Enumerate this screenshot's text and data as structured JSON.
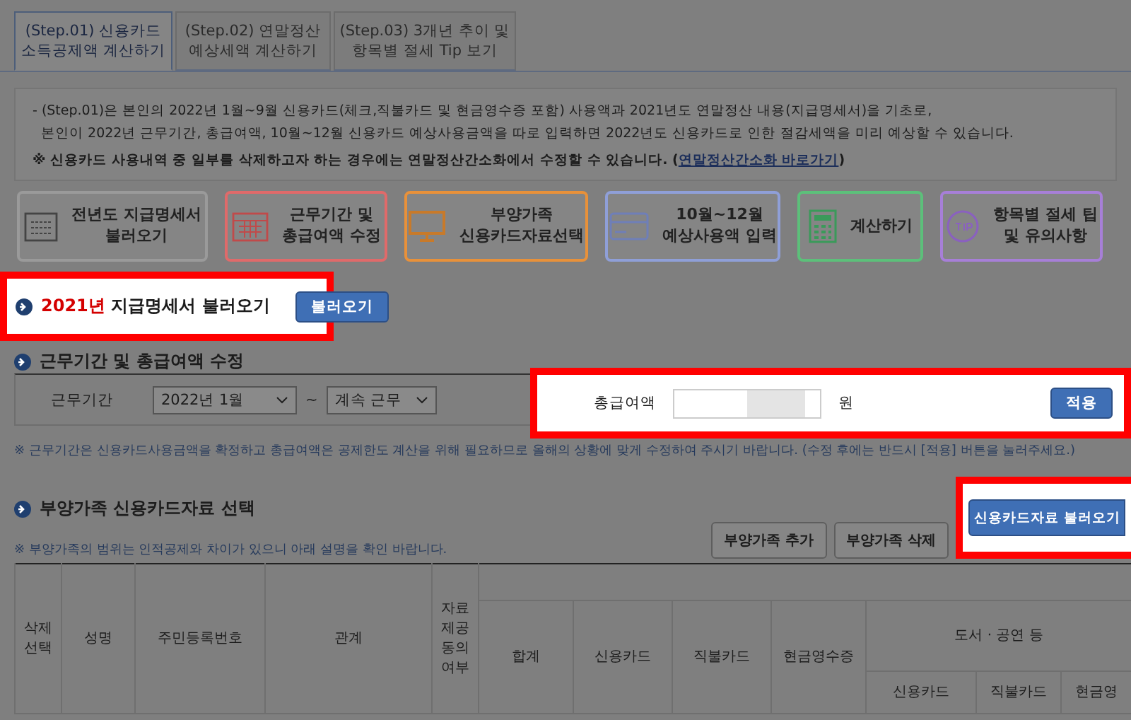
{
  "tabs": [
    {
      "label": "(Step.01) 신용카드\n소득공제액 계산하기",
      "selected": true
    },
    {
      "label": "(Step.02) 연말정산\n예상세액 계산하기",
      "selected": false
    },
    {
      "label": "(Step.03) 3개년 추이 및\n항목별 절세 Tip 보기",
      "selected": false
    }
  ],
  "notice": {
    "lines": [
      "- (Step.01)은 본인의 2022년 1월~9월 신용카드(체크,직불카드 및 현금영수증 포함) 사용액과 2021년도 연말정산 내용(지급명세서)을 기초로,",
      "본인이 2022년 근무기간, 총급여액, 10월~12월 신용카드 예상사용금액을 따로 입력하면 2022년도 신용카드로 인한 절감세액을 미리 예상할 수 있습니다."
    ],
    "note": "※ 신용카드 사용내역 중 일부를 삭제하고자 하는 경우에는 연말정산간소화에서 수정할 수 있습니다. (",
    "link": "연말정산간소화 바로가기",
    "note_end": ")"
  },
  "steps": [
    {
      "label": "전년도 지급명세서\n불러오기",
      "color": "#9a9a9a"
    },
    {
      "label": "근무기간 및\n총급여액 수정",
      "color": "#e06a6a"
    },
    {
      "label": "부양가족\n신용카드자료선택",
      "color": "#e8913a"
    },
    {
      "label": "10월~12월\n예상사용액 입력",
      "color": "#8f9fd8"
    },
    {
      "label": "계산하기",
      "color": "#5cc07a"
    },
    {
      "label": "항목별 절세 팁\n및 유의사항",
      "color": "#a77fd8"
    }
  ],
  "load_statement": {
    "year": "2021년",
    "title": "지급명세서 불러오기",
    "button": "불러오기",
    "highlighted": true
  },
  "work": {
    "title": "근무기간 및 총급여액 수정",
    "period_label": "근무기간",
    "start": "2022년 1월",
    "tilde": "~",
    "end": "계속 근무",
    "salary_label": "총급여액",
    "unit": "원",
    "apply": "적용",
    "highlighted": true,
    "note": "※ 근무기간은 신용카드사용금액을 확정하고 총급여액은 공제한도 계산을 위해 필요하므로 올해의 상황에 맞게 수정하여 주시기 바랍니다. (수정 후에는 반드시 [적용] 버튼을 눌러주세요.)"
  },
  "dependents": {
    "title": "부양가족 신용카드자료 선택",
    "note": "※ 부양가족의 범위는 인적공제와 차이가 있으니 아래 설명을 확인 바랍니다.",
    "add": "부양가족 추가",
    "delete": "부양가족 삭제",
    "load": "신용카드자료 불러오기",
    "load_highlighted": true
  },
  "table": {
    "columns": [
      "삭제\n선택",
      "성명",
      "주민등록번호",
      "관계",
      "자료\n제공\n동의\n여부"
    ],
    "sums": [
      "합계",
      "신용카드",
      "직불카드",
      "현금영수증"
    ],
    "group": "도서 · 공연 등",
    "subcolumns": [
      "신용카드",
      "직불카드",
      "현금영"
    ]
  }
}
